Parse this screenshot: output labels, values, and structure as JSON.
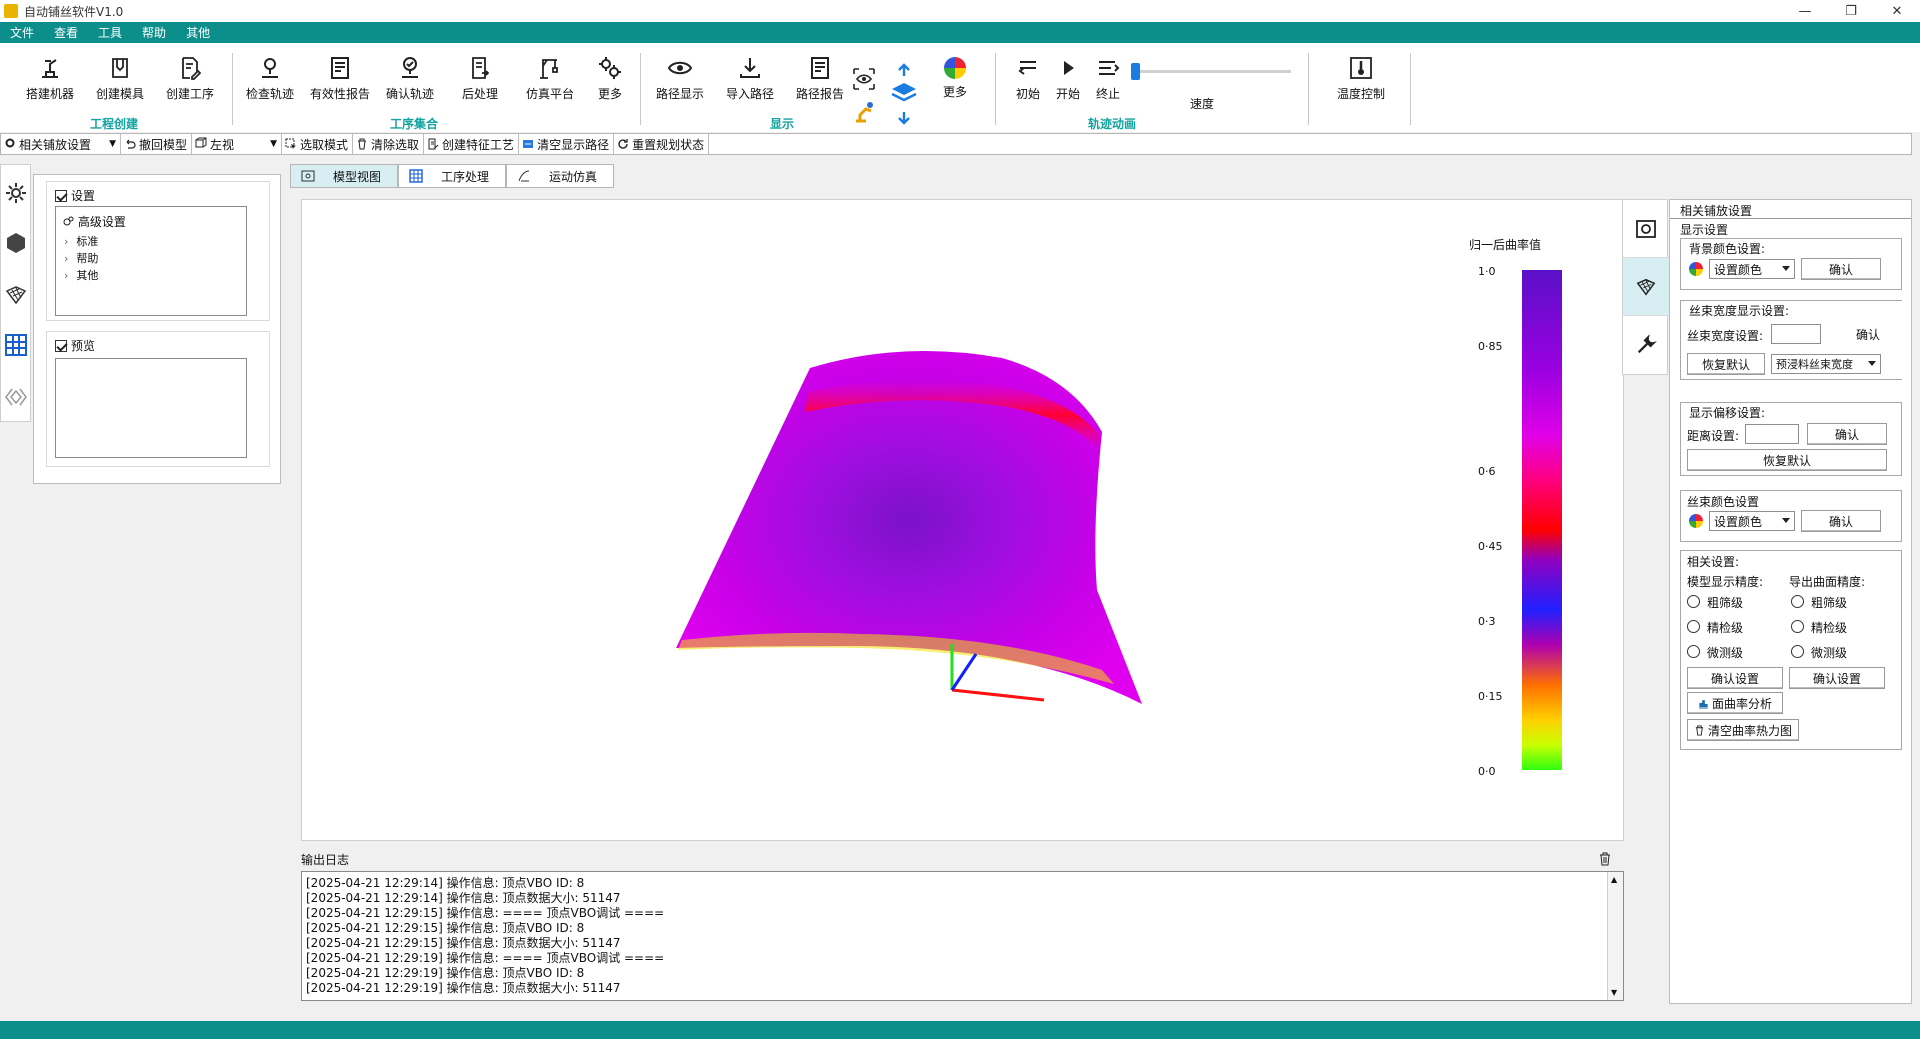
{
  "window": {
    "title": "自动铺丝软件V1.0",
    "buttons": [
      "—",
      "❐",
      "✕"
    ]
  },
  "menu": [
    "文件",
    "查看",
    "工具",
    "帮助",
    "其他"
  ],
  "ribbon": {
    "groups": [
      {
        "title": "工程创建",
        "buttons": [
          "搭建机器",
          "创建模具",
          "创建工序"
        ]
      },
      {
        "title": "工序集合",
        "buttons": [
          "检查轨迹",
          "有效性报告",
          "确认轨迹",
          "后处理",
          "仿真平台",
          "更多"
        ]
      },
      {
        "title": "显示",
        "buttons": [
          "路径显示",
          "导入路径",
          "路径报告",
          "更多"
        ]
      },
      {
        "title": "轨迹动画",
        "buttons": [
          "初始",
          "开始",
          "终止"
        ],
        "speed_label": "速度"
      },
      {
        "title": "",
        "buttons": [
          "温度控制"
        ]
      }
    ]
  },
  "toolbar": {
    "items": [
      "相关铺放设置",
      "撤回模型",
      "左视",
      "选取模式",
      "清除选取",
      "创建特征工艺",
      "清空显示路径",
      "重置规划状态"
    ]
  },
  "left_panel": {
    "settings_label": "设置",
    "tree_root": "高级设置",
    "tree_children": [
      "标准",
      "帮助",
      "其他"
    ],
    "preview_label": "预览"
  },
  "tabs": [
    "模型视图",
    "工序处理",
    "运动仿真"
  ],
  "colorbar": {
    "title": "归一后曲率值",
    "ticks": [
      "1·0",
      "0·85",
      "0·6",
      "0·45",
      "0·3",
      "0·15",
      "0·0"
    ]
  },
  "right_panel": {
    "header": "相关铺放设置",
    "display_settings": "显示设置",
    "bg_color": {
      "label": "背景颜色设置:",
      "select": "设置颜色",
      "confirm": "确认"
    },
    "tow_width": {
      "label": "丝束宽度显示设置:",
      "field_label": "丝束宽度设置:",
      "confirm": "确认",
      "reset": "恢复默认",
      "select": "预浸料丝束宽度"
    },
    "offset": {
      "label": "显示偏移设置:",
      "field_label": "距离设置:",
      "confirm": "确认",
      "reset": "恢复默认"
    },
    "tow_color": {
      "label": "丝束颜色设置",
      "select": "设置颜色",
      "confirm": "确认"
    },
    "related": {
      "label": "相关设置:",
      "model_precision": "模型显示精度:",
      "export_precision": "导出曲面精度:",
      "options": [
        "粗筛级",
        "精检级",
        "微测级"
      ],
      "confirm1": "确认设置",
      "confirm2": "确认设置",
      "curvature_button": "面曲率分析",
      "clear_button": "清空曲率热力图"
    }
  },
  "log": {
    "label": "输出日志",
    "lines": [
      "[2025-04-21 12:29:14] 操作信息: 顶点VBO ID: 8",
      "[2025-04-21 12:29:14] 操作信息: 顶点数据大小: 51147",
      "[2025-04-21 12:29:15] 操作信息: ==== 顶点VBO调试 ====",
      "[2025-04-21 12:29:15] 操作信息: 顶点VBO ID: 8",
      "[2025-04-21 12:29:15] 操作信息: 顶点数据大小: 51147",
      "[2025-04-21 12:29:19] 操作信息: ==== 顶点VBO调试 ====",
      "[2025-04-21 12:29:19] 操作信息: 顶点VBO ID: 8",
      "[2025-04-21 12:29:19] 操作信息: 顶点数据大小: 51147"
    ]
  },
  "colors": {
    "teal": "#0c8f8b",
    "group_title": "#13a3a0",
    "active_tab": "#d7eef3"
  }
}
